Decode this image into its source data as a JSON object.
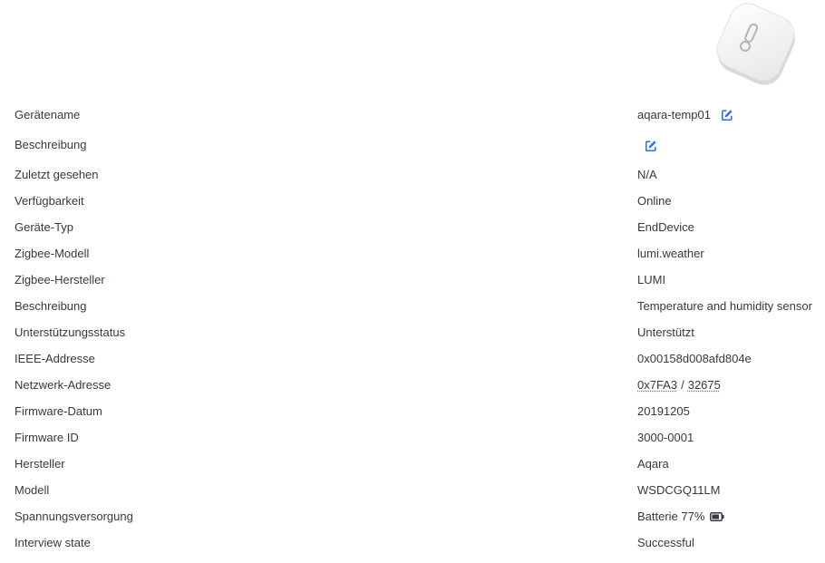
{
  "device": {
    "rows": [
      {
        "label": "Gerätename",
        "value": "aqara-temp01"
      },
      {
        "label": "Beschreibung",
        "value": ""
      },
      {
        "label": "Zuletzt gesehen",
        "value": "N/A"
      },
      {
        "label": "Verfügbarkeit",
        "value": "Online"
      },
      {
        "label": "Geräte-Typ",
        "value": "EndDevice"
      },
      {
        "label": "Zigbee-Modell",
        "value": "lumi.weather"
      },
      {
        "label": "Zigbee-Hersteller",
        "value": "LUMI"
      },
      {
        "label": "Beschreibung",
        "value": "Temperature and humidity sensor"
      },
      {
        "label": "Unterstützungsstatus",
        "value": "Unterstützt"
      },
      {
        "label": "IEEE-Addresse",
        "value": "0x00158d008afd804e"
      },
      {
        "label": "Netzwerk-Adresse",
        "value_hex": "0x7FA3",
        "separator": "/",
        "value_dec": "32675"
      },
      {
        "label": "Firmware-Datum",
        "value": "20191205"
      },
      {
        "label": "Firmware ID",
        "value": "3000-0001"
      },
      {
        "label": "Hersteller",
        "value": "Aqara"
      },
      {
        "label": "Modell",
        "value": "WSDCGQ11LM"
      },
      {
        "label": "Spannungsversorgung",
        "value": "Batterie 77%"
      },
      {
        "label": "Interview state",
        "value": "Successful"
      }
    ]
  },
  "icons": {
    "edit": "edit-icon",
    "battery": "battery-icon",
    "thermometer": "thermometer-icon"
  },
  "colors": {
    "link": "#2f6fd6",
    "supported": "#3aa14a",
    "edit_icon": "#2f6fd6"
  }
}
